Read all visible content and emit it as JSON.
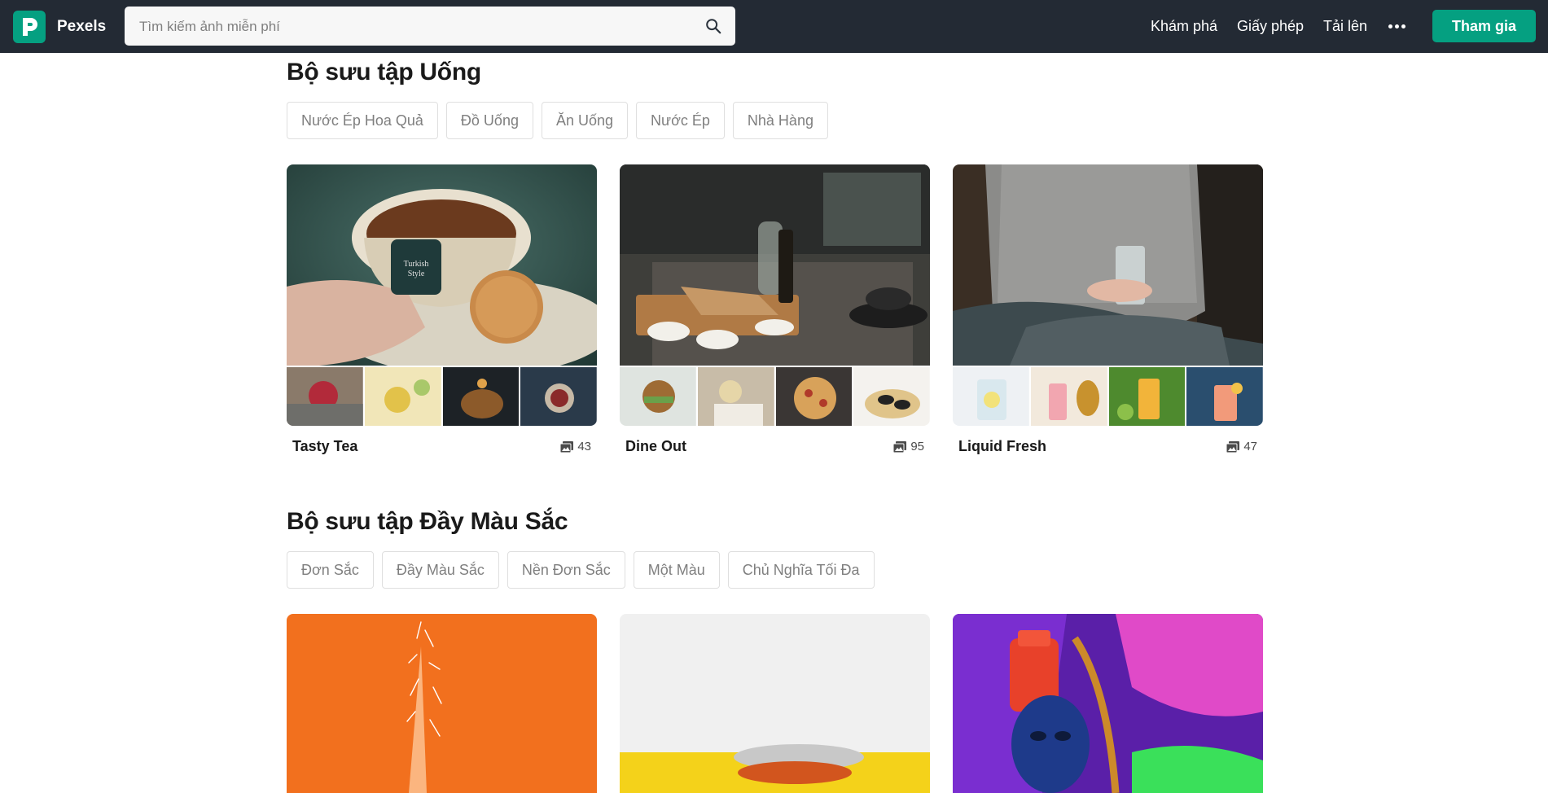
{
  "header": {
    "brand": "Pexels",
    "search_placeholder": "Tìm kiếm ảnh miễn phí",
    "nav": [
      "Khám phá",
      "Giấy phép",
      "Tải lên"
    ],
    "join_label": "Tham gia",
    "accent_color": "#05a081",
    "bg_color": "#232a34"
  },
  "sections": [
    {
      "title": "Bộ sưu tập Uống",
      "chips": [
        "Nước Ép Hoa Quả",
        "Đồ Uống",
        "Ăn Uống",
        "Nước Ép",
        "Nhà Hàng"
      ],
      "collections": [
        {
          "name": "Tasty Tea",
          "count": "43"
        },
        {
          "name": "Dine Out",
          "count": "95"
        },
        {
          "name": "Liquid Fresh",
          "count": "47"
        }
      ]
    },
    {
      "title": "Bộ sưu tập Đầy Màu Sắc",
      "chips": [
        "Đơn Sắc",
        "Đầy Màu Sắc",
        "Nền Đơn Sắc",
        "Một Màu",
        "Chủ Nghĩa Tối Đa"
      ]
    }
  ],
  "icons": {
    "search": "search-icon",
    "more": "more-dots-icon",
    "photo_count": "photos-icon"
  }
}
